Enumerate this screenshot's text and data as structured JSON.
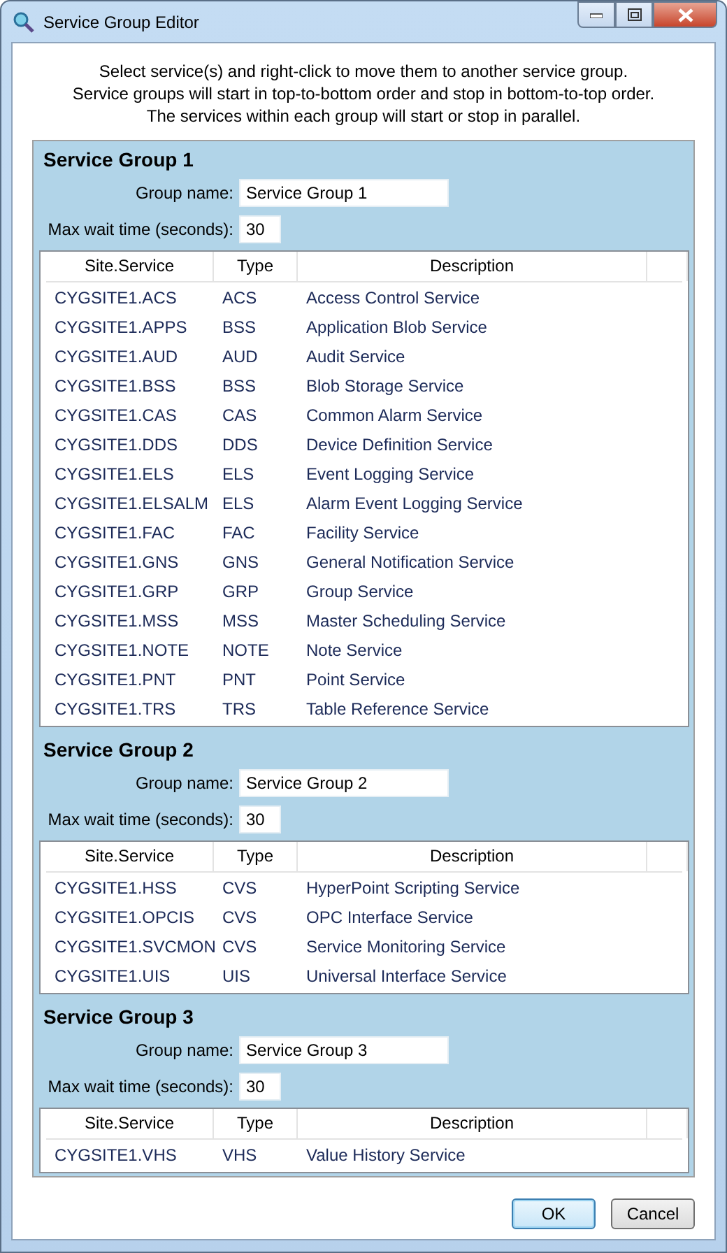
{
  "window": {
    "title": "Service Group Editor"
  },
  "instructions": [
    "Select service(s) and right-click to move them to another service group.",
    "Service groups will start in top-to-bottom order and stop in bottom-to-top order.",
    "The services within each group will start or stop in parallel."
  ],
  "groups": [
    {
      "heading": "Service Group 1",
      "name_label": "Group name:",
      "name_value": "Service Group 1",
      "wait_label": "Max wait time (seconds):",
      "wait_value": "30",
      "columns": [
        "Site.Service",
        "Type",
        "Description"
      ],
      "rows": [
        {
          "site": "CYGSITE1.ACS",
          "type": "ACS",
          "description": "Access Control Service"
        },
        {
          "site": "CYGSITE1.APPS",
          "type": "BSS",
          "description": "Application Blob Service"
        },
        {
          "site": "CYGSITE1.AUD",
          "type": "AUD",
          "description": "Audit Service"
        },
        {
          "site": "CYGSITE1.BSS",
          "type": "BSS",
          "description": "Blob Storage Service"
        },
        {
          "site": "CYGSITE1.CAS",
          "type": "CAS",
          "description": "Common Alarm Service"
        },
        {
          "site": "CYGSITE1.DDS",
          "type": "DDS",
          "description": "Device Definition Service"
        },
        {
          "site": "CYGSITE1.ELS",
          "type": "ELS",
          "description": "Event Logging Service"
        },
        {
          "site": "CYGSITE1.ELSALM",
          "type": "ELS",
          "description": "Alarm Event Logging Service"
        },
        {
          "site": "CYGSITE1.FAC",
          "type": "FAC",
          "description": "Facility Service"
        },
        {
          "site": "CYGSITE1.GNS",
          "type": "GNS",
          "description": "General Notification Service"
        },
        {
          "site": "CYGSITE1.GRP",
          "type": "GRP",
          "description": "Group Service"
        },
        {
          "site": "CYGSITE1.MSS",
          "type": "MSS",
          "description": "Master Scheduling Service"
        },
        {
          "site": "CYGSITE1.NOTE",
          "type": "NOTE",
          "description": "Note Service"
        },
        {
          "site": "CYGSITE1.PNT",
          "type": "PNT",
          "description": "Point Service"
        },
        {
          "site": "CYGSITE1.TRS",
          "type": "TRS",
          "description": "Table Reference Service"
        }
      ]
    },
    {
      "heading": "Service Group 2",
      "name_label": "Group name:",
      "name_value": "Service Group 2",
      "wait_label": "Max wait time (seconds):",
      "wait_value": "30",
      "columns": [
        "Site.Service",
        "Type",
        "Description"
      ],
      "rows": [
        {
          "site": "CYGSITE1.HSS",
          "type": "CVS",
          "description": "HyperPoint Scripting Service"
        },
        {
          "site": "CYGSITE1.OPCIS",
          "type": "CVS",
          "description": "OPC Interface Service"
        },
        {
          "site": "CYGSITE1.SVCMON",
          "type": "CVS",
          "description": "Service Monitoring Service"
        },
        {
          "site": "CYGSITE1.UIS",
          "type": "UIS",
          "description": "Universal Interface Service"
        }
      ]
    },
    {
      "heading": "Service Group 3",
      "name_label": "Group name:",
      "name_value": "Service Group 3",
      "wait_label": "Max wait time (seconds):",
      "wait_value": "30",
      "columns": [
        "Site.Service",
        "Type",
        "Description"
      ],
      "rows": [
        {
          "site": "CYGSITE1.VHS",
          "type": "VHS",
          "description": "Value History Service"
        }
      ]
    }
  ],
  "buttons": [
    {
      "label": "OK",
      "default": true
    },
    {
      "label": "Cancel",
      "default": false
    }
  ]
}
